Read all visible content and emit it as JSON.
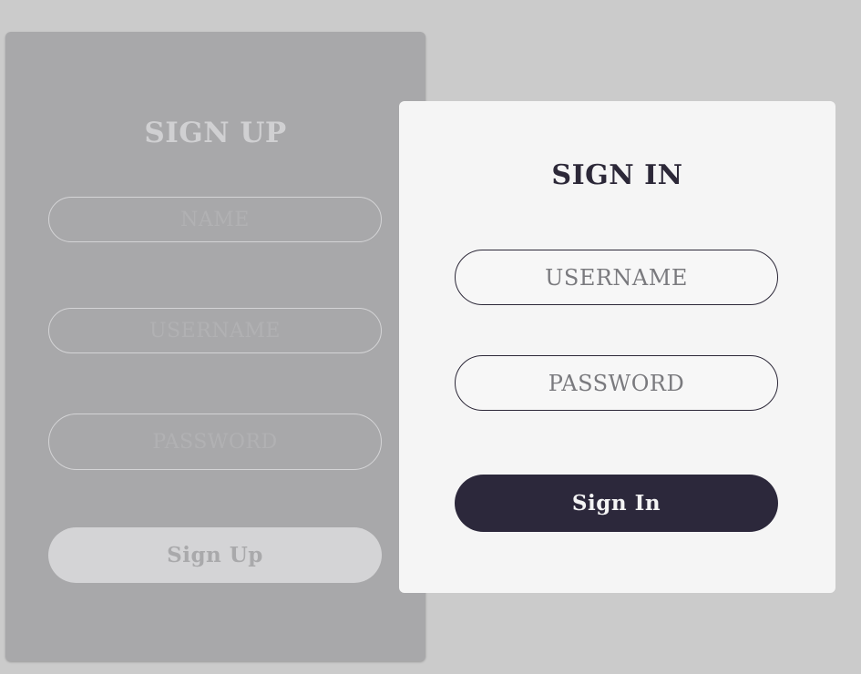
{
  "signup": {
    "title": "SIGN UP",
    "name_placeholder": "NAME",
    "username_placeholder": "USERNAME",
    "password_placeholder": "PASSWORD",
    "button_label": "Sign Up"
  },
  "signin": {
    "title": "SIGN IN",
    "username_placeholder": "USERNAME",
    "password_placeholder": "PASSWORD",
    "button_label": "Sign In"
  },
  "colors": {
    "background": "#cbcbcb",
    "signup_panel": "#a8a8aa",
    "signin_card": "#f5f5f5",
    "accent_dark": "#2c283b"
  }
}
